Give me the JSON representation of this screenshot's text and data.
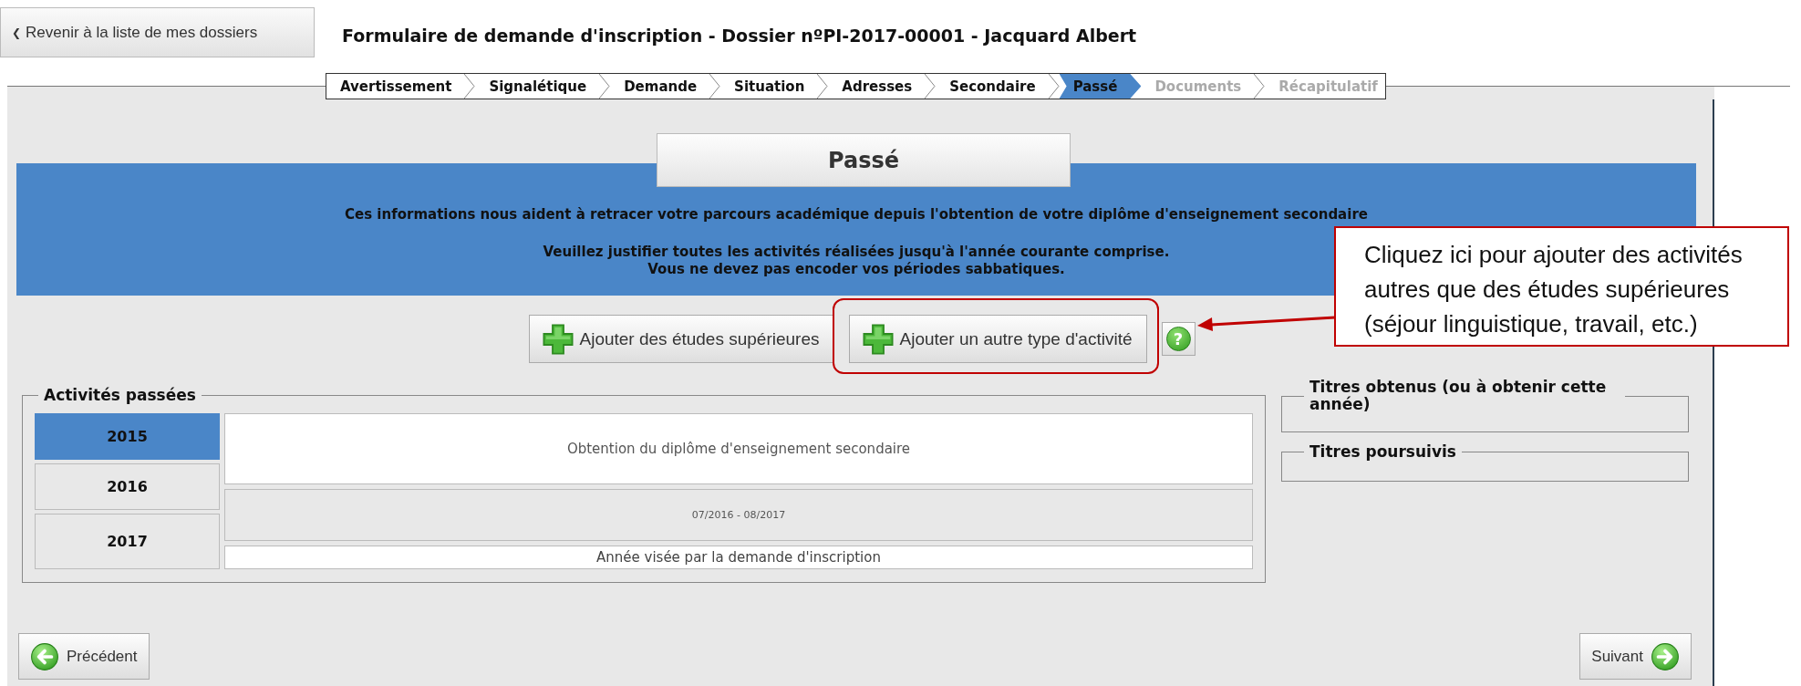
{
  "back_button": {
    "glyph": "❮",
    "label": "Revenir à la liste de mes dossiers"
  },
  "title": "Formulaire de demande d'inscription - Dossier nºPI-2017-00001 - Jacquard Albert",
  "steps": [
    {
      "label": "Avertissement",
      "selected": false,
      "disabled": false
    },
    {
      "label": "Signalétique",
      "selected": false,
      "disabled": false
    },
    {
      "label": "Demande",
      "selected": false,
      "disabled": false
    },
    {
      "label": "Situation",
      "selected": false,
      "disabled": false
    },
    {
      "label": "Adresses",
      "selected": false,
      "disabled": false
    },
    {
      "label": "Secondaire",
      "selected": false,
      "disabled": false
    },
    {
      "label": "Passé",
      "selected": true,
      "disabled": false
    },
    {
      "label": "Documents",
      "selected": false,
      "disabled": true
    },
    {
      "label": "Récapitulatif",
      "selected": false,
      "disabled": true
    }
  ],
  "section_title": "Passé",
  "info": {
    "intro": "Ces informations nous aident à retracer votre parcours académique depuis l'obtention de votre diplôme d'enseignement secondaire",
    "notes": [
      "Veuillez justifier toutes les activités réalisées jusqu'à l'année courante comprise.",
      "Vous ne devez pas encoder vos périodes sabbatiques."
    ]
  },
  "actions": [
    {
      "label": "Ajouter des études supérieures",
      "highlighted": false
    },
    {
      "label": "Ajouter un autre type d'activité",
      "highlighted": true
    }
  ],
  "help_button": {
    "label": "?"
  },
  "callout": {
    "lines": [
      "Cliquez ici pour ajouter des activités",
      "autres que des études supérieures",
      "(séjour linguistique, travail, etc.)"
    ]
  },
  "activities": {
    "legend": "Activités passées",
    "years": [
      {
        "label": "2015",
        "selected": true
      },
      {
        "label": "2016",
        "selected": false
      },
      {
        "label": "2017",
        "selected": false
      }
    ],
    "entries": [
      {
        "kind": "activity",
        "text": "Obtention du diplôme d'enseignement secondaire"
      },
      {
        "kind": "period",
        "text": "07/2016 - 08/2017"
      },
      {
        "kind": "target",
        "text": "Année visée par la demande d'inscription"
      }
    ]
  },
  "titles": [
    {
      "legend": "Titres obtenus (ou à obtenir cette année)"
    },
    {
      "legend": "Titres poursuivis"
    }
  ],
  "nav": {
    "previous": "Précédent",
    "next": "Suivant"
  }
}
